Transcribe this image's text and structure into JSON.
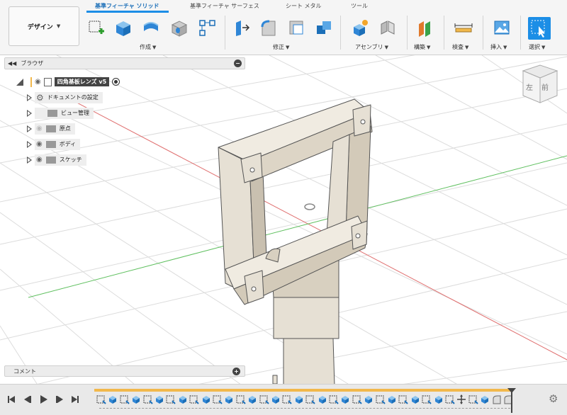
{
  "workspace": {
    "label": "デザイン"
  },
  "tabs": [
    {
      "label": "基準フィーチャ ソリッド",
      "active": true
    },
    {
      "label": "基準フィーチャ サーフェス",
      "active": false
    },
    {
      "label": "シート メタル",
      "active": false
    },
    {
      "label": "ツール",
      "active": false
    }
  ],
  "groups": {
    "create": "作成",
    "modify": "修正",
    "assemble": "アセンブリ",
    "construct": "構築",
    "inspect": "検査",
    "insert": "挿入",
    "select": "選択"
  },
  "browser": {
    "title": "ブラウザ",
    "root": "四角基板レンズ v5",
    "items": [
      {
        "label": "ドキュメントの設定",
        "icon": "gear-icon"
      },
      {
        "label": "ビュー管理",
        "icon": "folder-icon"
      },
      {
        "label": "原点",
        "icon": "folder-icon",
        "hidden": true
      },
      {
        "label": "ボディ",
        "icon": "folder-icon"
      },
      {
        "label": "スケッチ",
        "icon": "folder-icon"
      }
    ]
  },
  "viewcube": {
    "left": "左",
    "front": "前"
  },
  "comments": {
    "title": "コメント"
  },
  "colors": {
    "accent": "#1c8ee6",
    "model": "#e6e0d4",
    "model_dark": "#c9c0b0",
    "timeline_bar": "#f2b84b"
  }
}
